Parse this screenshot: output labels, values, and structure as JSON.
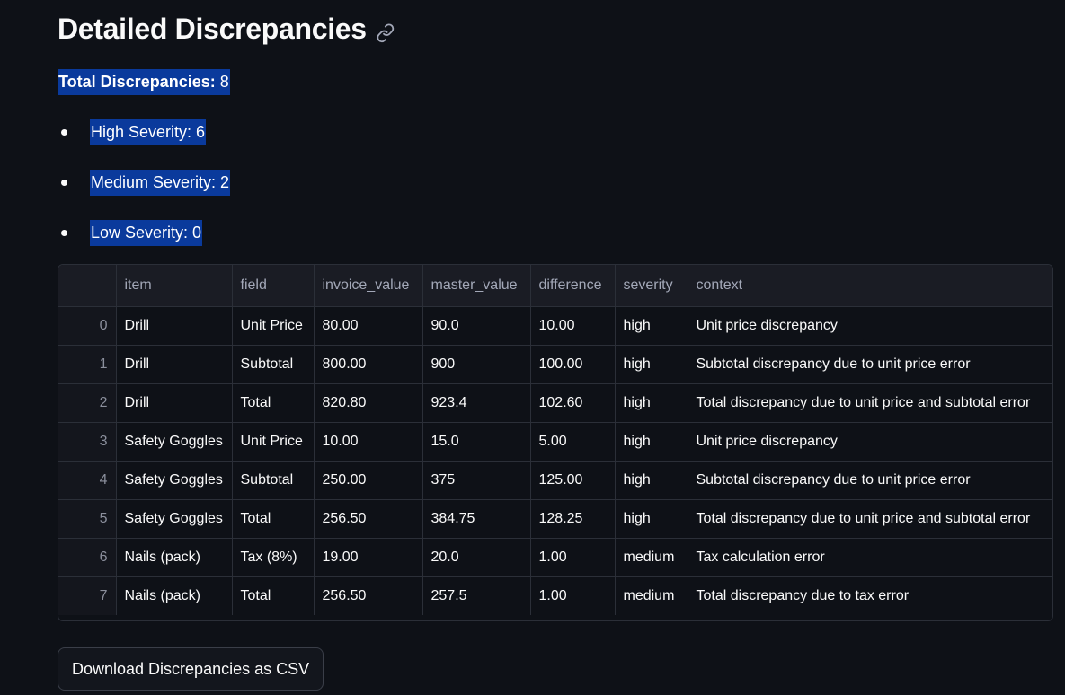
{
  "header": {
    "title": "Detailed Discrepancies",
    "anchor_icon": "link-icon"
  },
  "summary": {
    "total_label": "Total Discrepancies:",
    "total_value": "8",
    "high": "High Severity: 6",
    "medium": "Medium Severity: 2",
    "low": "Low Severity: 0"
  },
  "table": {
    "columns": [
      "",
      "item",
      "field",
      "invoice_value",
      "master_value",
      "difference",
      "severity",
      "context"
    ],
    "rows": [
      [
        "0",
        "Drill",
        "Unit Price",
        "80.00",
        "90.0",
        "10.00",
        "high",
        "Unit price discrepancy"
      ],
      [
        "1",
        "Drill",
        "Subtotal",
        "800.00",
        "900",
        "100.00",
        "high",
        "Subtotal discrepancy due to unit price error"
      ],
      [
        "2",
        "Drill",
        "Total",
        "820.80",
        "923.4",
        "102.60",
        "high",
        "Total discrepancy due to unit price and subtotal error"
      ],
      [
        "3",
        "Safety Goggles",
        "Unit Price",
        "10.00",
        "15.0",
        "5.00",
        "high",
        "Unit price discrepancy"
      ],
      [
        "4",
        "Safety Goggles",
        "Subtotal",
        "250.00",
        "375",
        "125.00",
        "high",
        "Subtotal discrepancy due to unit price error"
      ],
      [
        "5",
        "Safety Goggles",
        "Total",
        "256.50",
        "384.75",
        "128.25",
        "high",
        "Total discrepancy due to unit price and subtotal error"
      ],
      [
        "6",
        "Nails (pack)",
        "Tax (8%)",
        "19.00",
        "20.0",
        "1.00",
        "medium",
        "Tax calculation error"
      ],
      [
        "7",
        "Nails (pack)",
        "Total",
        "256.50",
        "257.5",
        "1.00",
        "medium",
        "Total discrepancy due to tax error"
      ]
    ]
  },
  "download_button": {
    "label": "Download Discrepancies as CSV"
  },
  "colors": {
    "background": "#0e1117",
    "highlight": "#0a3a9c",
    "table_header": "#1a1c24",
    "border": "#2b2f38"
  }
}
